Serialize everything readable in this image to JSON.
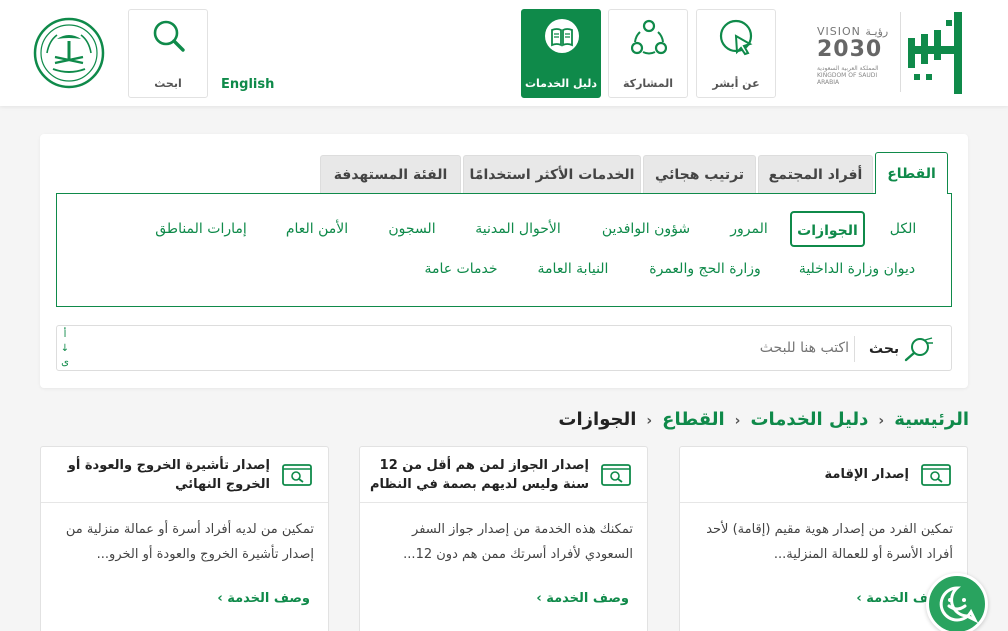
{
  "header": {
    "vision": {
      "line1": "VISION رؤيـة",
      "line2": "2030",
      "line3": "المملكة العربية السعودية KINGDOM OF SAUDI ARABIA"
    },
    "nav": [
      {
        "label": "عن أبشر",
        "icon": "cursor-click-icon"
      },
      {
        "label": "المشاركة",
        "icon": "share-network-icon"
      },
      {
        "label": "دليل الخدمات",
        "icon": "book-icon",
        "active": true
      },
      {
        "label": "ابحث",
        "icon": "search-icon"
      }
    ],
    "lang": "English"
  },
  "tabs": [
    "القطاع",
    "أفراد المجتمع",
    "ترتيب هجائي",
    "الخدمات الأكثر استخدامًا",
    "الفئة المستهدفة"
  ],
  "sectors": {
    "row1": [
      "الكل",
      "الجوازات",
      "المرور",
      "شؤون الوافدين",
      "الأحوال المدنية",
      "السجون",
      "الأمن العام",
      "إمارات المناطق"
    ],
    "row2": [
      "ديوان وزارة الداخلية",
      "وزارة الحج والعمرة",
      "النيابة العامة",
      "خدمات عامة"
    ]
  },
  "search": {
    "label": "بحث",
    "placeholder": "اكتب هنا للبحث",
    "sort": [
      "أ",
      "↓",
      "ی"
    ]
  },
  "breadcrumb": {
    "home": "الرئيسية",
    "guide": "دليل الخدمات",
    "sector": "القطاع",
    "current": "الجوازات"
  },
  "services": [
    {
      "title": "إصدار الإقامة",
      "desc": "تمكين الفرد من إصدار هوية مقيم (إقامة) لأحد أفراد الأسرة أو للعمالة المنزلية...",
      "more": "وصف الخدمة ›"
    },
    {
      "title": "إصدار الجواز لمن هم أقل من 12 سنة وليس لديهم بصمة في النظام",
      "desc": "تمكنك هذه الخدمة من إصدار جواز السفر السعودي لأفراد أسرتك ممن هم دون 12...",
      "more": "وصف الخدمة ›"
    },
    {
      "title": "إصدار تأشيرة الخروج والعودة أو الخروج النهائي",
      "desc": "تمكين من لديه أفراد أسرة أو عمالة منزلية من إصدار تأشيرة الخروج والعودة أو الخرو...",
      "more": "وصف الخدمة ›"
    }
  ],
  "colors": {
    "brand": "#0f8a4a",
    "accent": "#29a35f"
  }
}
